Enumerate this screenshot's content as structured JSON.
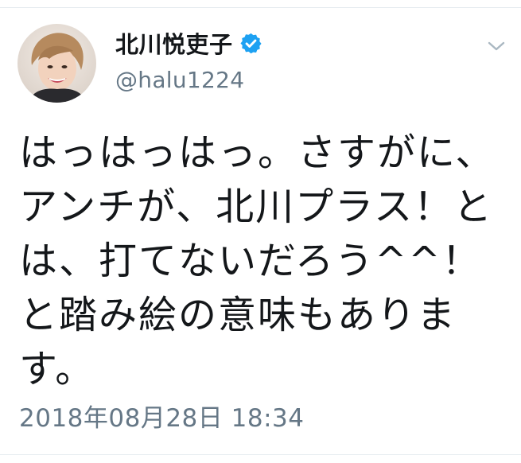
{
  "tweet": {
    "display_name": "北川悦吏子",
    "handle": "@halu1224",
    "verified": true,
    "text": "はっはっはっ。さすがに、アンチが、北川プラス！とは、打てないだろう^^！と踏み絵の意味もあります。",
    "timestamp": "2018年08月28日 18:34"
  },
  "icons": {
    "verified": "verified-badge-icon",
    "menu": "chevron-down-icon",
    "avatar": "profile-photo"
  },
  "colors": {
    "verified_blue": "#1da1f2",
    "secondary_text": "#657786",
    "primary_text": "#14171a"
  }
}
